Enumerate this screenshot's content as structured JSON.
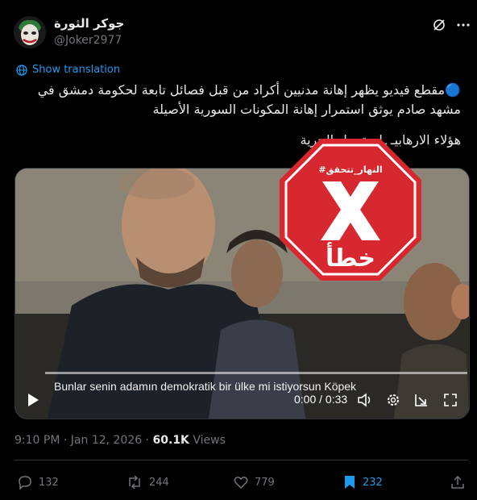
{
  "header": {
    "display_name": "جوكر الثورة",
    "handle": "@Joker2977",
    "avatar_icon": "joker-avatar-icon"
  },
  "translate": {
    "label": "Show translation"
  },
  "tweet": {
    "line1": "🔵مقطع فيديو يظهر إهانة مدنيين أكراد من قبل فصائل تابعة لحكومة دمشق في",
    "line2": "مشهد صادم يوثق استمرار إهانة المكونات السورية الأصيلة",
    "line3": "هؤلاء الارهابيـ  ـايرة بدل الحرية"
  },
  "video": {
    "subtitle": "Bunlar senin adamın demokratik bir ülke mi istiyorsun Köpek",
    "time": "0:00 / 0:33",
    "progress": 0
  },
  "stamp": {
    "source_label": "#النهار_تتحقق",
    "verdict": "خطأ",
    "color": "#d6282e"
  },
  "meta": {
    "time": "9:10 PM",
    "date": "Jan 12, 2026",
    "views_count": "60.1K",
    "views_label": "Views"
  },
  "actions": {
    "replies": "132",
    "reposts": "244",
    "likes": "779",
    "bookmarks": "232"
  },
  "colors": {
    "accent": "#1d9bf0",
    "muted": "#71767b",
    "background": "#000000"
  }
}
